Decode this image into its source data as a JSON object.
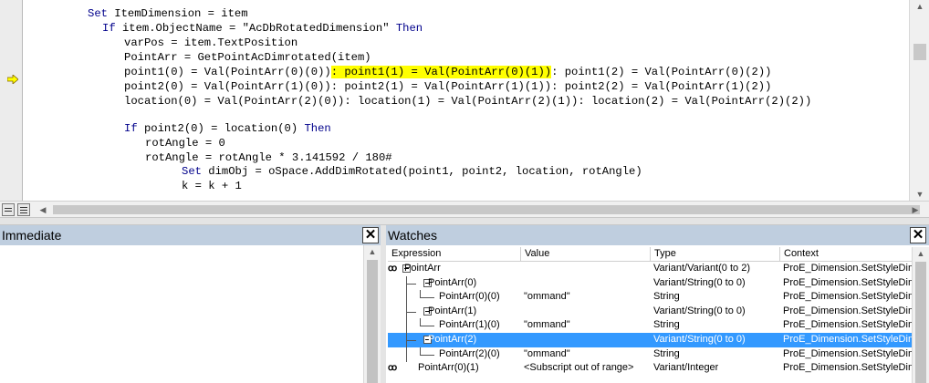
{
  "code": {
    "lines": [
      {
        "parts": [
          {
            "t": "Set",
            "c": "kw"
          },
          {
            "t": " ItemDimension = item",
            "c": ""
          }
        ]
      },
      {
        "parts": [
          {
            "t": "If",
            "c": "kw"
          },
          {
            "t": " item.ObjectName = \"AcDbRotatedDimension\" ",
            "c": ""
          },
          {
            "t": "Then",
            "c": "kw"
          }
        ]
      },
      {
        "parts": [
          {
            "t": "varPos = item.TextPosition",
            "c": ""
          }
        ]
      },
      {
        "parts": [
          {
            "t": "PointArr = GetPointAcDimrotated(item)",
            "c": ""
          }
        ]
      },
      {
        "parts": [
          {
            "t": "point1(0) = Val(PointArr(0)(0))",
            "c": ""
          },
          {
            "t": ": point1(1) = Val(PointArr(0)(1))",
            "c": "hl"
          },
          {
            "t": ": point1(2) = Val(PointArr(0)(2))",
            "c": ""
          }
        ]
      },
      {
        "parts": [
          {
            "t": "point2(0) = Val(PointArr(1)(0)): point2(1) = Val(PointArr(1)(1)): point2(2) = Val(PointArr(1)(2))",
            "c": ""
          }
        ]
      },
      {
        "parts": [
          {
            "t": "location(0) = Val(PointArr(2)(0)): location(1) = Val(PointArr(2)(1)): location(2) = Val(PointArr(2)(2))",
            "c": ""
          }
        ]
      },
      {
        "parts": [
          {
            "t": "",
            "c": ""
          }
        ]
      },
      {
        "parts": [
          {
            "t": "If",
            "c": "kw"
          },
          {
            "t": " point2(0) = location(0) ",
            "c": ""
          },
          {
            "t": "Then",
            "c": "kw"
          }
        ]
      },
      {
        "parts": [
          {
            "t": "rotAngle = 0",
            "c": ""
          }
        ]
      },
      {
        "parts": [
          {
            "t": "rotAngle = rotAngle * 3.141592 / 180#",
            "c": ""
          }
        ]
      },
      {
        "parts": [
          {
            "t": "Set",
            "c": "kw"
          },
          {
            "t": " dimObj = oSpace.AddDimRotated(point1, point2, location, rotAngle)",
            "c": ""
          }
        ]
      },
      {
        "parts": [
          {
            "t": "k = k + 1",
            "c": ""
          }
        ]
      }
    ]
  },
  "immediate": {
    "title": "Immediate",
    "close": "✕"
  },
  "watches": {
    "title": "Watches",
    "close": "✕",
    "columns": [
      "Expression",
      "Value",
      "Type",
      "Context"
    ],
    "rows": [
      {
        "expr": "PointArr",
        "value": "",
        "type": "Variant/Variant(0 to 2)",
        "context": "ProE_Dimension.SetStyleDimension",
        "glasses": "ꝏ",
        "selected": false
      },
      {
        "expr": "PointArr(0)",
        "value": "",
        "type": "Variant/String(0 to 0)",
        "context": "ProE_Dimension.SetStyleDimension",
        "glasses": "",
        "selected": false
      },
      {
        "expr": "PointArr(0)(0)",
        "value": "\"ommand\"",
        "type": "String",
        "context": "ProE_Dimension.SetStyleDimension",
        "glasses": "",
        "selected": false
      },
      {
        "expr": "PointArr(1)",
        "value": "",
        "type": "Variant/String(0 to 0)",
        "context": "ProE_Dimension.SetStyleDimension",
        "glasses": "",
        "selected": false
      },
      {
        "expr": "PointArr(1)(0)",
        "value": "\"ommand\"",
        "type": "String",
        "context": "ProE_Dimension.SetStyleDimension",
        "glasses": "",
        "selected": false
      },
      {
        "expr": "PointArr(2)",
        "value": "",
        "type": "Variant/String(0 to 0)",
        "context": "ProE_Dimension.SetStyleDimension",
        "glasses": "",
        "selected": true
      },
      {
        "expr": "PointArr(2)(0)",
        "value": "\"ommand\"",
        "type": "String",
        "context": "ProE_Dimension.SetStyleDimension",
        "glasses": "",
        "selected": false
      },
      {
        "expr": "PointArr(0)(1)",
        "value": "<Subscript out of range>",
        "type": "Variant/Integer",
        "context": "ProE_Dimension.SetStyleDimension",
        "glasses": "ꝏ",
        "selected": false
      }
    ]
  },
  "colors": {
    "keyword": "#00008b",
    "highlight": "#ffff00",
    "pane_title": "#bfcedf",
    "selection": "#3399ff"
  }
}
